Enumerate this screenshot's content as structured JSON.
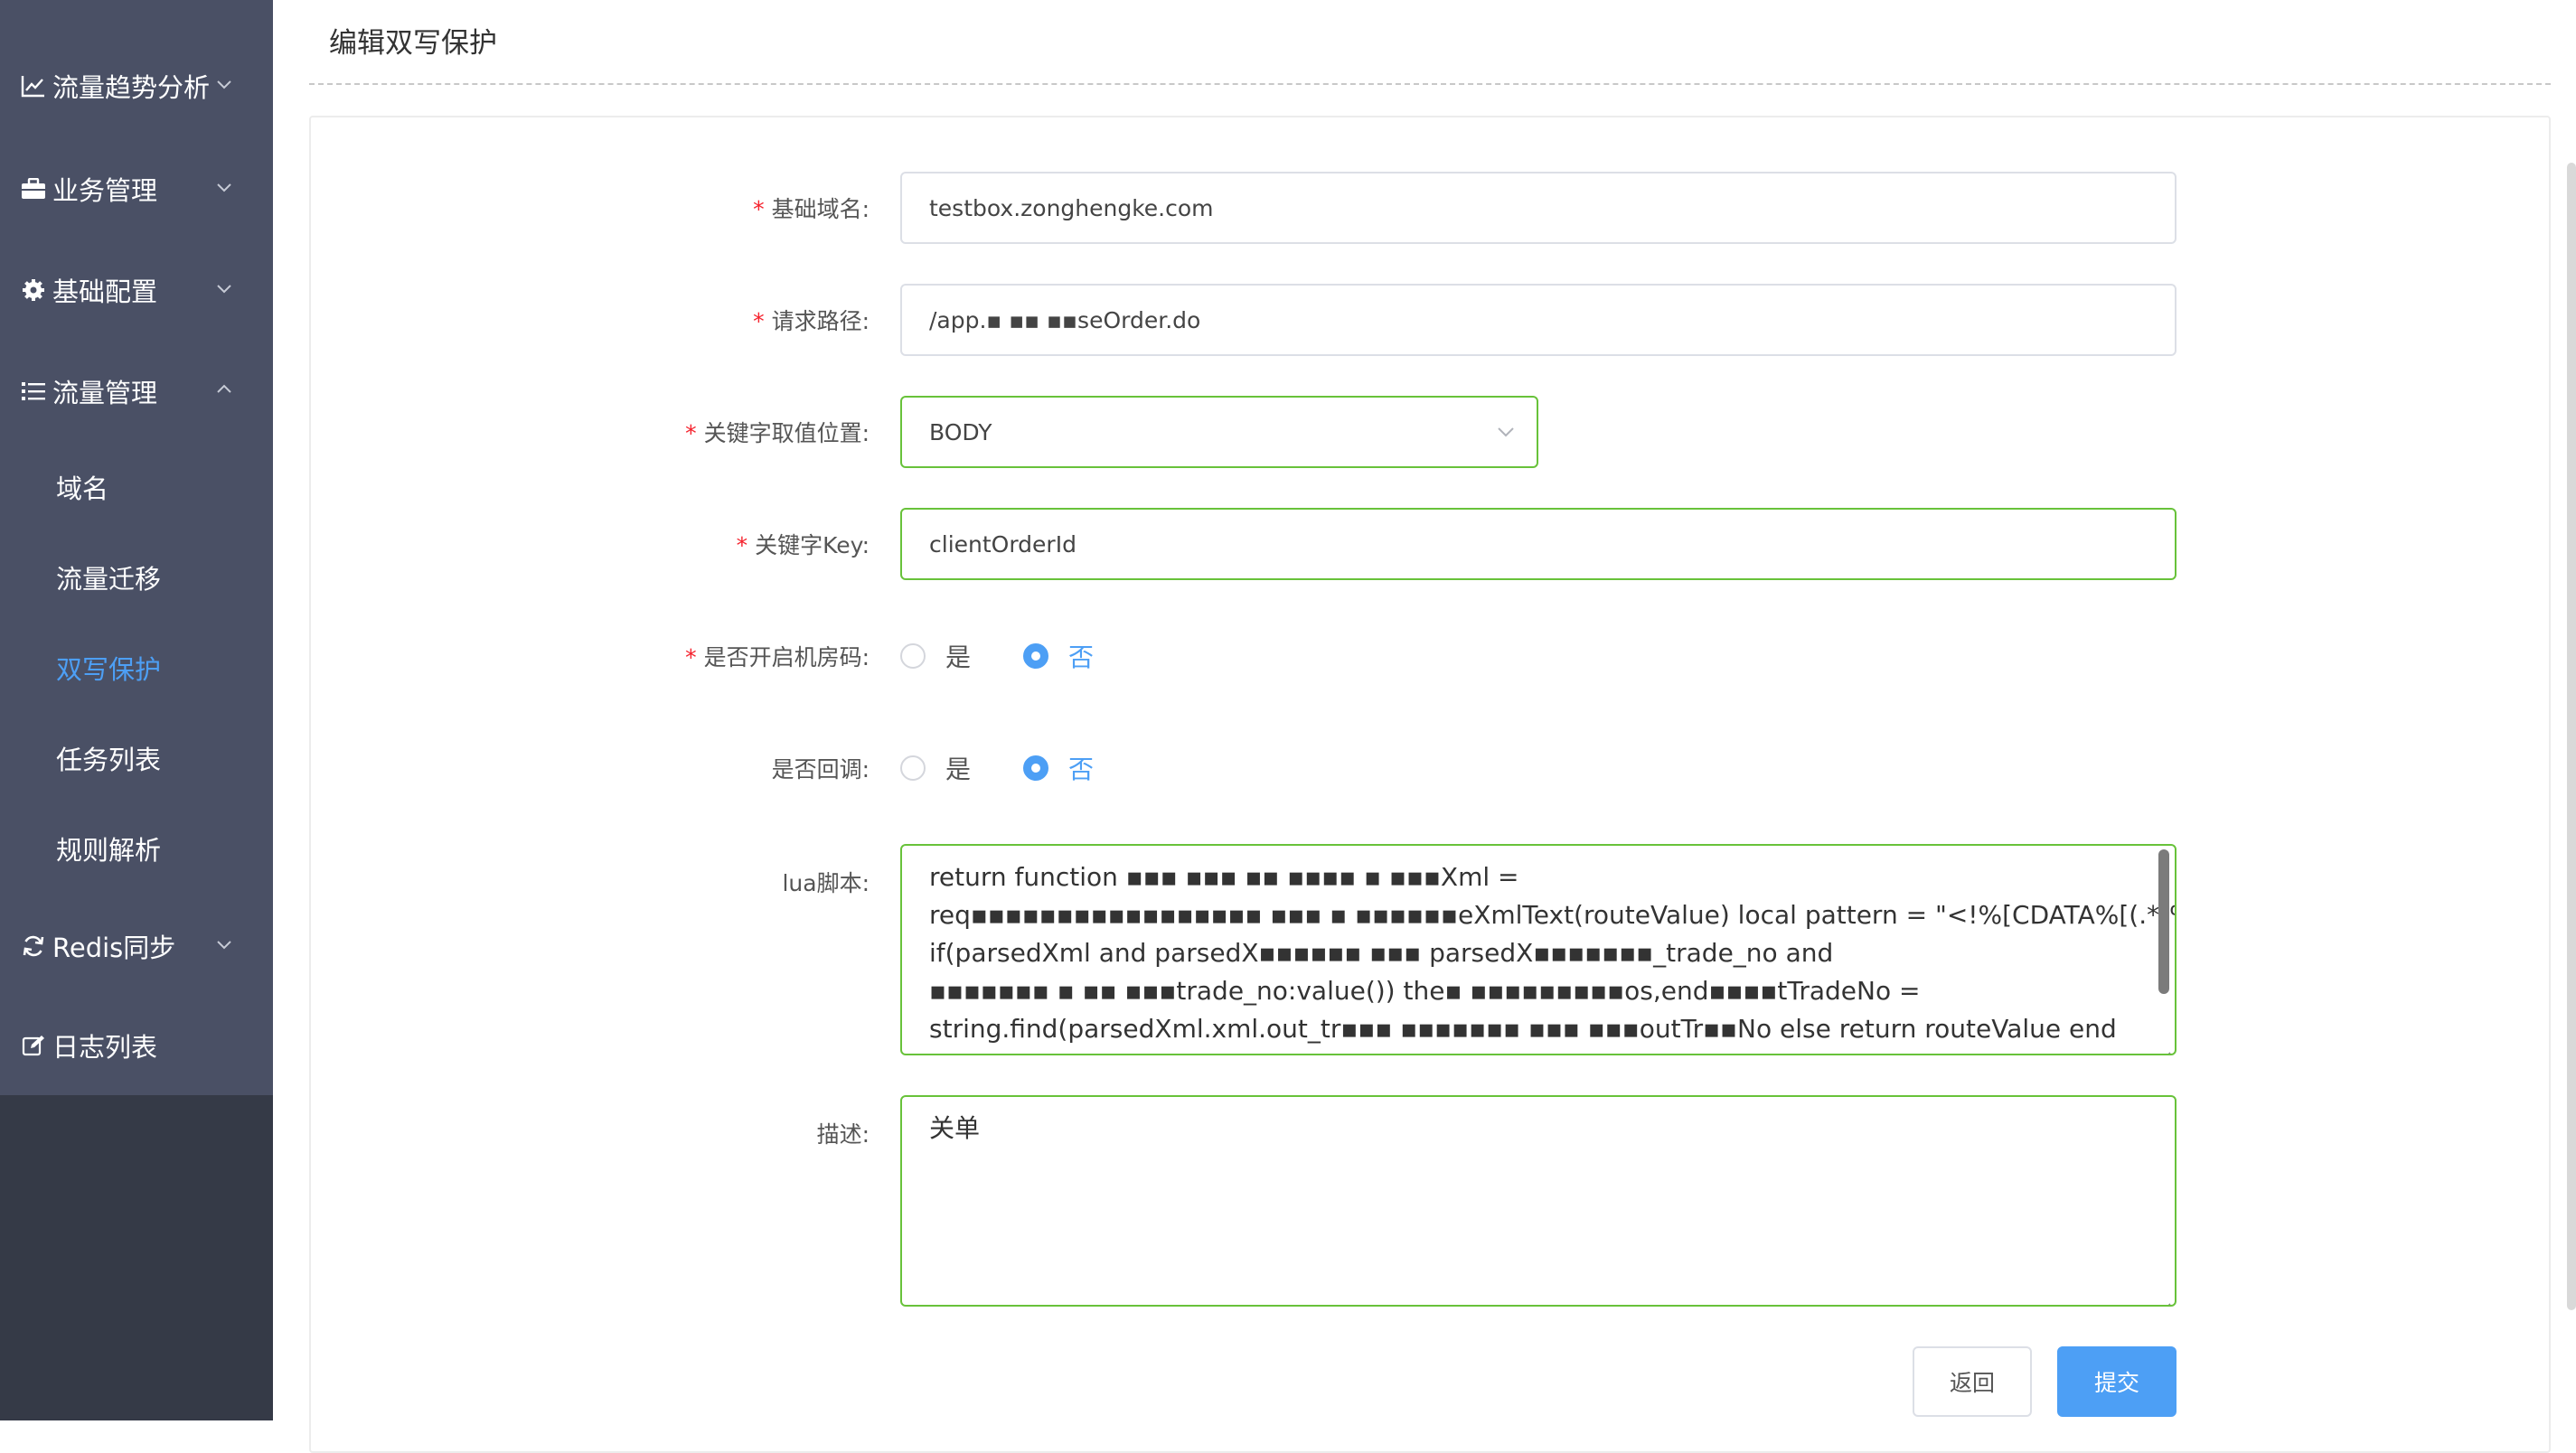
{
  "sidebar": {
    "items": [
      {
        "label": "流量趋势分析",
        "icon": "line-chart-icon",
        "arrow": "chevron-down-icon"
      },
      {
        "label": "业务管理",
        "icon": "briefcase-icon",
        "arrow": "chevron-down-icon"
      },
      {
        "label": "基础配置",
        "icon": "gear-icon",
        "arrow": "chevron-down-icon"
      },
      {
        "label": "流量管理",
        "icon": "list-icon",
        "arrow": "chevron-up-icon"
      },
      {
        "label": "Redis同步",
        "icon": "sync-icon",
        "arrow": "chevron-down-icon"
      },
      {
        "label": "日志列表",
        "icon": "edit-icon",
        "arrow": ""
      }
    ],
    "sub_items": [
      {
        "label": "域名"
      },
      {
        "label": "流量迁移"
      },
      {
        "label": "双写保护",
        "active": true
      },
      {
        "label": "任务列表"
      },
      {
        "label": "规则解析"
      }
    ],
    "active_color": "#4d9ff5"
  },
  "page": {
    "title": "编辑双写保护"
  },
  "form": {
    "required_mark": "*",
    "domain": {
      "label": "基础域名:",
      "value": "testbox.zonghengke.com"
    },
    "path": {
      "label": "请求路径:",
      "value": "/app.▪ ▪▪ ▪▪seOrder.do"
    },
    "key_location": {
      "label": "关键字取值位置:",
      "value": "BODY"
    },
    "key": {
      "label": "关键字Key:",
      "value": "clientOrderId"
    },
    "datacenter": {
      "label": "是否开启机房码:",
      "options": [
        "是",
        "否"
      ],
      "selected": "否"
    },
    "callback": {
      "label": "是否回调:",
      "options": [
        "是",
        "否"
      ],
      "selected": "否"
    },
    "lua": {
      "label": "lua脚本:",
      "lines": [
        "return function ▪▪▪ ▪▪▪ ▪▪ ▪▪▪▪ ▪ ▪▪▪Xml =",
        "req▪▪▪▪▪▪▪▪▪▪▪▪▪▪▪▪▪ ▪▪▪ ▪ ▪▪▪▪▪▪eXmlText(routeValue) local pattern = \"<!%[CDATA%[(.*)%]%]\"",
        "if(parsedXml and parsedX▪▪▪▪▪▪ ▪▪▪ parsedX▪▪▪▪▪▪▪_trade_no and",
        "▪▪▪▪▪▪▪ ▪ ▪▪ ▪▪▪trade_no:value()) the▪ ▪▪▪▪▪▪▪▪▪os,end▪▪▪▪tTradeNo =",
        "string.find(parsedXml.xml.out_tr▪▪▪ ▪▪▪▪▪▪▪ ▪▪▪ ▪▪▪outTr▪▪No else return routeValue end"
      ]
    },
    "description": {
      "label": "描述:",
      "value": "关单"
    }
  },
  "buttons": {
    "back": "返回",
    "submit": "提交"
  },
  "colors": {
    "sidebar_bg": "#4a5065",
    "sidebar_bottom": "#353a47",
    "primary": "#4d9ff5",
    "focus_border": "#68c23a",
    "required": "#f5222d"
  }
}
